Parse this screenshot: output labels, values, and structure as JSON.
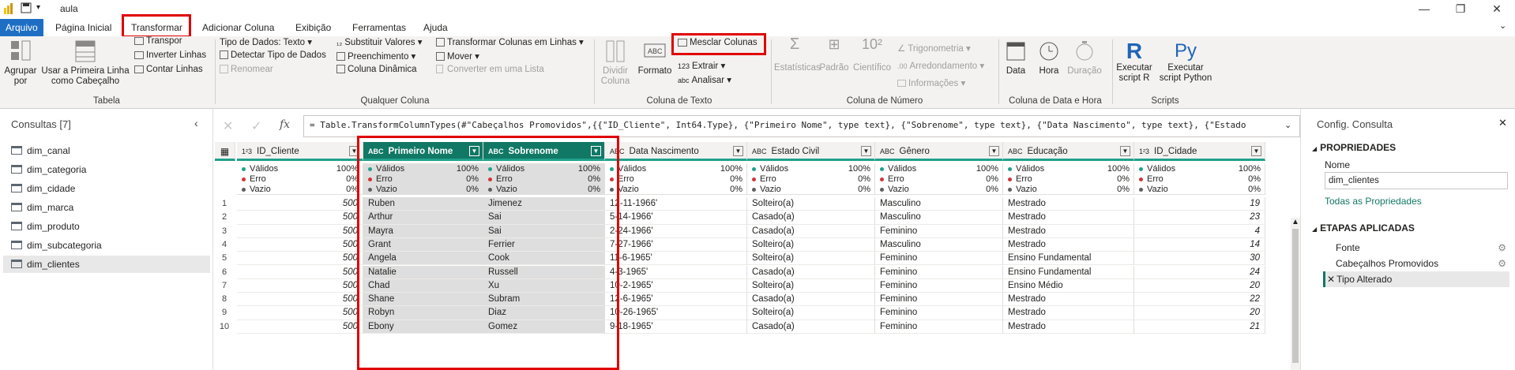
{
  "titlebar": {
    "title": "aula"
  },
  "tabs": [
    "Arquivo",
    "Página Inicial",
    "Transformar",
    "Adicionar Coluna",
    "Exibição",
    "Ferramentas",
    "Ajuda"
  ],
  "ribbon": {
    "tabela": {
      "agrupar": "Agrupar\npor",
      "primeira_linha": "Usar a Primeira Linha\ncomo Cabeçalho",
      "transpor": "Transpor",
      "inverter": "Inverter Linhas",
      "contar": "Contar Linhas",
      "label": "Tabela"
    },
    "qualquer_coluna": {
      "tipo_dados": "Tipo de Dados: Texto",
      "detectar": "Detectar Tipo de Dados",
      "renomear": "Renomear",
      "substituir": "Substituir Valores",
      "preenchimento": "Preenchimento",
      "coluna_dinamica": "Coluna Dinâmica",
      "transformar_colunas": "Transformar Colunas em Linhas",
      "mover": "Mover",
      "converter_lista": "Converter em uma Lista",
      "label": "Qualquer Coluna"
    },
    "coluna_texto": {
      "dividir": "Dividir\nColuna",
      "formato": "Formato",
      "mesclar": "Mesclar Colunas",
      "extrair": "Extrair",
      "analisar": "Analisar",
      "label": "Coluna de Texto"
    },
    "coluna_numero": {
      "estatisticas": "Estatísticas",
      "padrao": "Padrão",
      "cientifico": "Científico",
      "trigonometria": "Trigonometria",
      "arredondamento": "Arredondamento",
      "informacoes": "Informações",
      "label": "Coluna de Número"
    },
    "data_hora": {
      "data": "Data",
      "hora": "Hora",
      "duracao": "Duração",
      "label": "Coluna de Data e Hora"
    },
    "scripts": {
      "executar_r": "Executar\nscript R",
      "executar_py": "Executar\nscript Python",
      "label": "Scripts"
    }
  },
  "consultas": {
    "title": "Consultas [7]",
    "items": [
      "dim_canal",
      "dim_categoria",
      "dim_cidade",
      "dim_marca",
      "dim_produto",
      "dim_subcategoria",
      "dim_clientes"
    ],
    "selected": "dim_clientes"
  },
  "formula": "= Table.TransformColumnTypes(#\"Cabeçalhos Promovidos\",{{\"ID_Cliente\", Int64.Type}, {\"Primeiro Nome\", type text}, {\"Sobrenome\", type text}, {\"Data Nascimento\", type text}, {\"Estado",
  "grid": {
    "columns": [
      {
        "type": "1²3",
        "name": "ID_Cliente",
        "valid": "100%",
        "error": "0%",
        "empty": "0%"
      },
      {
        "type": "ABC",
        "name": "Primeiro Nome",
        "valid": "100%",
        "error": "0%",
        "empty": "0%"
      },
      {
        "type": "ABC",
        "name": "Sobrenome",
        "valid": "100%",
        "error": "0%",
        "empty": "0%"
      },
      {
        "type": "ABC",
        "name": "Data Nascimento",
        "valid": "100%",
        "error": "0%",
        "empty": "0%"
      },
      {
        "type": "ABC",
        "name": "Estado Civil",
        "valid": "100%",
        "error": "0%",
        "empty": "0%"
      },
      {
        "type": "ABC",
        "name": "Gênero",
        "valid": "100%",
        "error": "0%",
        "empty": "0%"
      },
      {
        "type": "ABC",
        "name": "Educação",
        "valid": "100%",
        "error": "0%",
        "empty": "0%"
      },
      {
        "type": "1²3",
        "name": "ID_Cidade",
        "valid": "100%",
        "error": "0%",
        "empty": "0%"
      }
    ],
    "profile_labels": {
      "valid": "Válidos",
      "error": "Erro",
      "empty": "Vazio"
    },
    "rows": [
      [
        "1",
        "500",
        "Ruben",
        "Jimenez",
        "12-11-1966'",
        "Solteiro(a)",
        "Masculino",
        "Mestrado",
        "19"
      ],
      [
        "2",
        "500",
        "Arthur",
        "Sai",
        "5-14-1966'",
        "Casado(a)",
        "Masculino",
        "Mestrado",
        "23"
      ],
      [
        "3",
        "500",
        "Mayra",
        "Sai",
        "2-24-1966'",
        "Casado(a)",
        "Feminino",
        "Mestrado",
        "4"
      ],
      [
        "4",
        "500",
        "Grant",
        "Ferrier",
        "7-27-1966'",
        "Solteiro(a)",
        "Masculino",
        "Mestrado",
        "14"
      ],
      [
        "5",
        "500",
        "Angela",
        "Cook",
        "11-6-1965'",
        "Solteiro(a)",
        "Feminino",
        "Ensino Fundamental",
        "30"
      ],
      [
        "6",
        "500",
        "Natalie",
        "Russell",
        "4-3-1965'",
        "Casado(a)",
        "Feminino",
        "Ensino Fundamental",
        "24"
      ],
      [
        "7",
        "500",
        "Chad",
        "Xu",
        "10-2-1965'",
        "Solteiro(a)",
        "Feminino",
        "Ensino Médio",
        "20"
      ],
      [
        "8",
        "500",
        "Shane",
        "Subram",
        "12-6-1965'",
        "Casado(a)",
        "Feminino",
        "Mestrado",
        "22"
      ],
      [
        "9",
        "500",
        "Robyn",
        "Diaz",
        "10-26-1965'",
        "Solteiro(a)",
        "Feminino",
        "Mestrado",
        "20"
      ],
      [
        "10",
        "500",
        "Ebony",
        "Gomez",
        "9-18-1965'",
        "Casado(a)",
        "Feminino",
        "Mestrado",
        "21"
      ]
    ]
  },
  "config": {
    "title": "Config. Consulta",
    "propriedades": "PROPRIEDADES",
    "nome_label": "Nome",
    "nome_value": "dim_clientes",
    "todas": "Todas as Propriedades",
    "etapas": "ETAPAS APLICADAS",
    "steps": [
      "Fonte",
      "Cabeçalhos Promovidos",
      "Tipo Alterado"
    ]
  },
  "colors": {
    "accent": "#117865",
    "highlight": "#e00000",
    "file_tab": "#1e6fc4"
  }
}
